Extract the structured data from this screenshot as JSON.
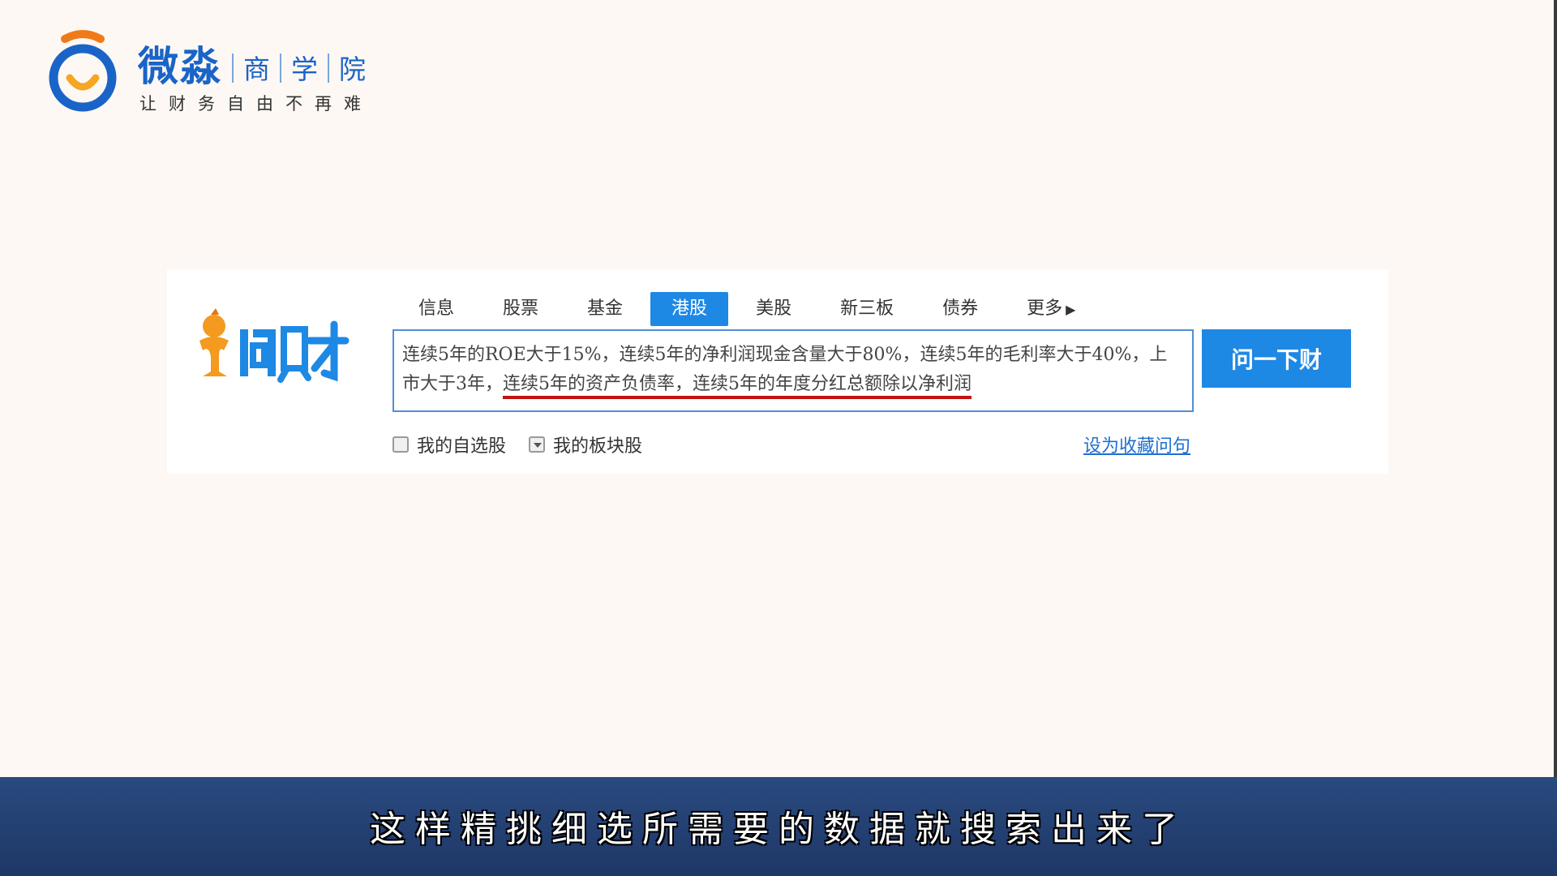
{
  "brand": {
    "name": "微淼",
    "sub1": "商",
    "sub2": "学",
    "sub3": "院",
    "slogan": "让财务自由不再难"
  },
  "wencai": {
    "logo_text": "问财",
    "tabs": [
      {
        "label": "信息",
        "active": false
      },
      {
        "label": "股票",
        "active": false
      },
      {
        "label": "基金",
        "active": false
      },
      {
        "label": "港股",
        "active": true
      },
      {
        "label": "美股",
        "active": false
      },
      {
        "label": "新三板",
        "active": false
      },
      {
        "label": "债券",
        "active": false
      },
      {
        "label": "更多",
        "active": false
      }
    ],
    "query_plain": "连续5年的ROE大于15%，连续5年的净利润现金含量大于80%，连续5年的毛利率大于40%，上市大于3年，",
    "query_underlined": "连续5年的资产负债率，连续5年的年度分红总额除以净利润",
    "ask_button": "问一下财",
    "option_self_selected": "我的自选股",
    "option_sector": "我的板块股",
    "save_link": "设为收藏问句"
  },
  "subtitle": "这样精挑细选所需要的数据就搜索出来了",
  "colors": {
    "accent_blue": "#1e88e5",
    "brand_blue": "#1a64c8",
    "brand_orange": "#f07a1a",
    "underline_red": "#c31212",
    "subtitle_bar": "#1e3766"
  }
}
